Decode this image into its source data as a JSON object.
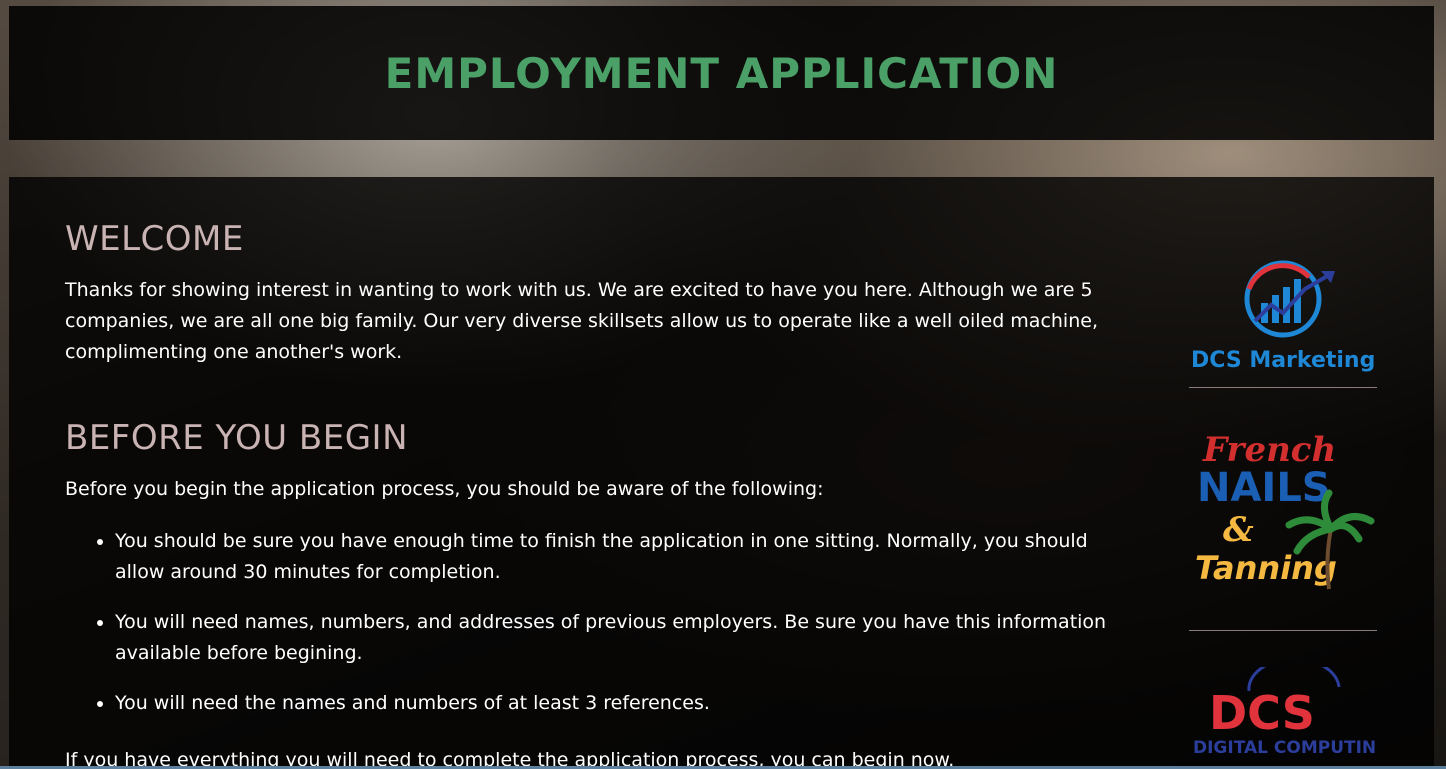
{
  "header": {
    "title": "EMPLOYMENT APPLICATION"
  },
  "welcome": {
    "heading": "WELCOME",
    "text": "Thanks for showing interest in wanting to work with us. We are excited to have you here. Although we are 5 companies, we are all one big family. Our very diverse skillsets allow us to operate like a well oiled machine, complimenting one another's work."
  },
  "before": {
    "heading": "BEFORE YOU BEGIN",
    "intro": "Before you begin the application process, you should be aware of the following:",
    "items": [
      "You should be sure you have enough time to finish the application in one sitting. Normally, you should allow around 30 minutes for completion.",
      "You will need names, numbers, and addresses of previous employers. Be sure you have this information available before begining.",
      "You will need the names and numbers of at least 3 references."
    ],
    "final": "If you have everything you will need to complete the application process, you can begin now."
  },
  "sidebar": {
    "logos": [
      {
        "name": "DCS Marketing",
        "text": "DCS Marketing"
      },
      {
        "name": "French Nails & Tanning",
        "line1": "French",
        "line2": "NAILS",
        "line3": "&",
        "line4": "Tanning"
      },
      {
        "name": "DCS Digital Computing",
        "line1": "DCS",
        "line2": "DIGITAL COMPUTING"
      }
    ]
  },
  "colors": {
    "title_green": "#4aa066",
    "heading_pink": "#c9b3b3",
    "dcs_blue": "#1e88d6",
    "dcs_red": "#e0333c",
    "nails_blue": "#1a5fb4",
    "tanning_yellow": "#f5b942"
  }
}
